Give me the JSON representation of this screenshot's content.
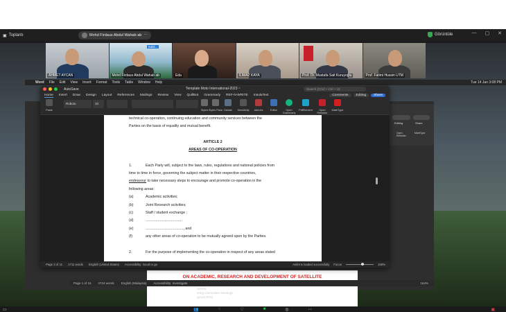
{
  "zoom": {
    "app_label": "Toplantı",
    "active_speaker": "Mohd Firdaus Abdul Wahab ab",
    "view_label": "Görüntüle",
    "participants": [
      {
        "name": "AHMET AYCAN"
      },
      {
        "name": "Mohd Firdaus Abdul Wahab ab",
        "badge": "Sabil..."
      },
      {
        "name": "Eda"
      },
      {
        "name": "ILIMAZ KAYA"
      },
      {
        "name": "Prof. Dr. Mustafa Sait Kuruyoğlu"
      },
      {
        "name": "Prof. Fatimi Hussin UTM"
      }
    ]
  },
  "mac_menubar": {
    "items": [
      "Word",
      "File",
      "Edit",
      "View",
      "Insert",
      "Format",
      "Tools",
      "Table",
      "Window",
      "Help"
    ],
    "clock": "Tue 14 Jan  3:08 PM"
  },
  "word": {
    "autosave": "AutoSave",
    "title": "Template Moto International-2023 ~",
    "search_placeholder": "Search (Cmd + Ctrl + U)",
    "tabs": [
      "Home",
      "Insert",
      "Draw",
      "Design",
      "Layout",
      "References",
      "Mailings",
      "Review",
      "View",
      "QuillBot",
      "Grammarly",
      "REF-N-WRITE",
      "InsulaText"
    ],
    "active_tab": "Home",
    "comments_btn": "Comments",
    "editing_btn": "Editing",
    "share_btn": "Share",
    "ribbon": {
      "paste": "Paste",
      "font": "Roboto",
      "size": "10",
      "styles": "Styles",
      "styles_pane": "Styles Pane",
      "dictate": "Dictate",
      "sensitivity": "Sensitivity",
      "add_ins": "Add-ins",
      "editor": "Editor",
      "open_grammarly": "Open Grammarly",
      "pdfelement": "PdfElement",
      "open_refwriter": "Open Refwriter",
      "mathtype": "MathType"
    },
    "document": {
      "line1": "technical co-operation, continuing education and community services between the",
      "line2": "Parties on the basis of equality and mutual benefit.",
      "article": "ARTICLE 2",
      "heading": "AREAS OF CO-OPERATION",
      "para1_num": "1.",
      "para1_a": "Each Party will, subject to the laws, rules, regulations and national policies from",
      "para1_b": "time to time in force, governing the subject matter in their respective countries,",
      "para1_c_u": "endeavour",
      "para1_c": " to take necessary steps to encourage and promote co-operation in the",
      "para1_d": "following areas:",
      "items": [
        {
          "k": "(a)",
          "v": "Academic activities;"
        },
        {
          "k": "(b)",
          "v": "Joint Research activities;"
        },
        {
          "k": "(c)",
          "v": "Staff / student exchange ;"
        },
        {
          "k": "(d)",
          "v": "...................................."
        },
        {
          "k": "(e)",
          "v": "....................................., and"
        },
        {
          "k": "(f)",
          "v": "any other areas of co-operation to be mutually agreed upon by the Parties."
        }
      ],
      "para2_num": "2.",
      "para2": "For the purpose of implementing the co-operation in respect of any areas stated"
    },
    "status": {
      "page": "Page 3 of 11",
      "words": "1711 words",
      "lang": "English (United States)",
      "accessibility": "Accessibility: Good to go",
      "addin": "Add-ins loaded successfully",
      "focus": "Focus",
      "zoom": "158%"
    }
  },
  "background_doc": {
    "red_title": "ON ACADEMIC, RESEARCH AND DEVELOPMENT OF SATELLITE",
    "page": "Page 1 of 16",
    "words": "2724 words",
    "lang": "English (Malaysia)",
    "accessibility": "Accessibility: Investigate",
    "focus": "Focus",
    "zoom": "164%",
    "low_lines": [
      "UNIVE",
      "ering Committee Meetings",
      "ignosi 2020"
    ],
    "right_buttons": [
      "Editing",
      "Share",
      "Open Refwriter",
      "MathType"
    ]
  },
  "colors": {
    "share": "#2f6fd1",
    "red_title": "#d02020",
    "record": "#27c24c"
  }
}
